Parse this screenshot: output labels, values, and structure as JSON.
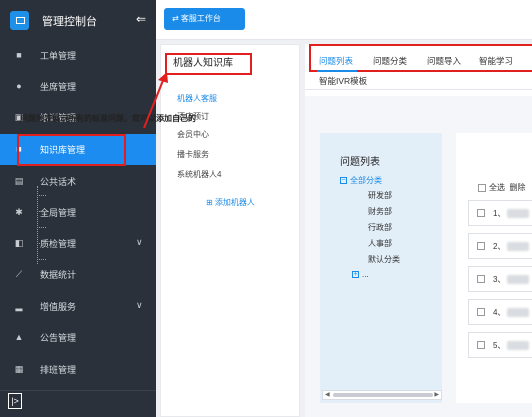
{
  "sidebar": {
    "title": "管理控制台",
    "collapse_icon": "⇐",
    "items": [
      {
        "label": "工单管理",
        "icon": "file-icon"
      },
      {
        "label": "坐席管理",
        "icon": "user-icon"
      },
      {
        "label": "培训管理",
        "icon": "training-icon"
      },
      {
        "label": "知识库管理",
        "icon": "book-icon",
        "active": true
      },
      {
        "label": "公共话术",
        "icon": "script-icon"
      },
      {
        "label": "全局管理",
        "icon": "gear-icon"
      },
      {
        "label": "质检管理",
        "icon": "quality-icon",
        "chevron": true
      },
      {
        "label": "数据统计",
        "icon": "chart-icon"
      },
      {
        "label": "增值服务",
        "icon": "bar-icon",
        "chevron": true
      },
      {
        "label": "公告管理",
        "icon": "bell-icon"
      },
      {
        "label": "排班管理",
        "icon": "calendar-icon"
      }
    ],
    "footer_icon": "|>"
  },
  "topbar": {
    "button_label": "⇄ 客服工作台"
  },
  "kb": {
    "title": "机器人知识库",
    "items": [
      "机器人客服",
      "酒店预订",
      "会员中心",
      "播卡服务",
      "系统机器人4"
    ],
    "add_label": "⊞ 添加机器人"
  },
  "tabs": [
    "问题列表",
    "问题分类",
    "问题导入",
    "智能学习"
  ],
  "tab_second_row": "智能IVR模板",
  "description": "问题列表展示所有的标准问题，您可以添加自己的",
  "question_list": {
    "title": "问题列表",
    "root": "全部分类",
    "children": [
      "研发部",
      "财务部",
      "行政部",
      "人事部",
      "默认分类"
    ],
    "more": "..."
  },
  "toolbar": {
    "select_all": "全选",
    "delete": "删除"
  },
  "rows": [
    "1、",
    "2、",
    "3、",
    "4、",
    "5、"
  ],
  "colors": {
    "accent": "#1a8be8",
    "sidebar": "#2b313a",
    "annotation": "#e21f1f"
  }
}
